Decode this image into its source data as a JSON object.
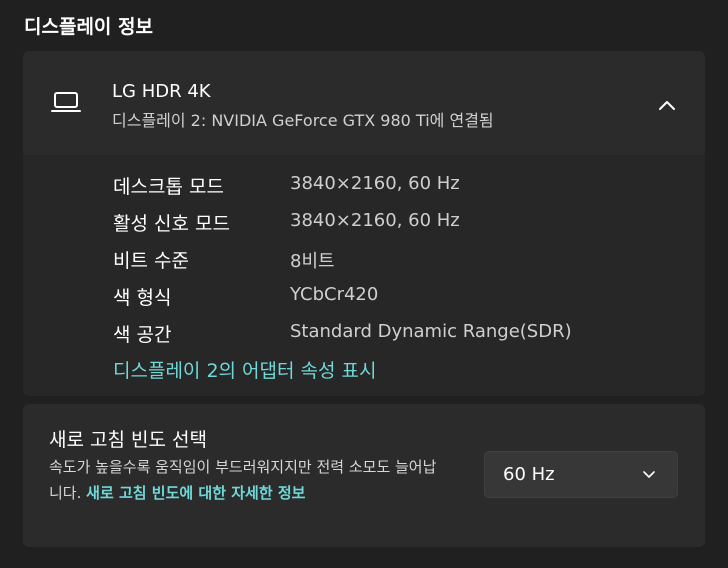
{
  "section": {
    "title": "디스플레이 정보"
  },
  "display": {
    "icon": "laptop-icon",
    "name": "LG HDR 4K",
    "subtitle": "디스플레이 2: NVIDIA GeForce GTX 980 Ti에 연결됨",
    "collapse_icon": "chevron-up-icon"
  },
  "details": {
    "rows": [
      {
        "label": "데스크톱 모드",
        "value": "3840×2160, 60 Hz"
      },
      {
        "label": "활성 신호 모드",
        "value": "3840×2160, 60 Hz"
      },
      {
        "label": "비트 수준",
        "value": "8비트"
      },
      {
        "label": "색 형식",
        "value": "YCbCr420"
      },
      {
        "label": "색 공간",
        "value": "Standard Dynamic Range(SDR)"
      }
    ],
    "adapter_link": "디스플레이 2의 어댑터 속성 표시"
  },
  "refresh": {
    "title": "새로 고침 빈도 선택",
    "description": "속도가 높을수록 움직임이 부드러워지지만 전력 소모도 늘어납니다.",
    "link": "새로 고침 빈도에 대한 자세한 정보",
    "selected": "60 Hz",
    "dropdown_icon": "chevron-down-icon"
  },
  "colors": {
    "background": "#202020",
    "card": "#2b2b2b",
    "accent_link": "#6fd8d8"
  }
}
